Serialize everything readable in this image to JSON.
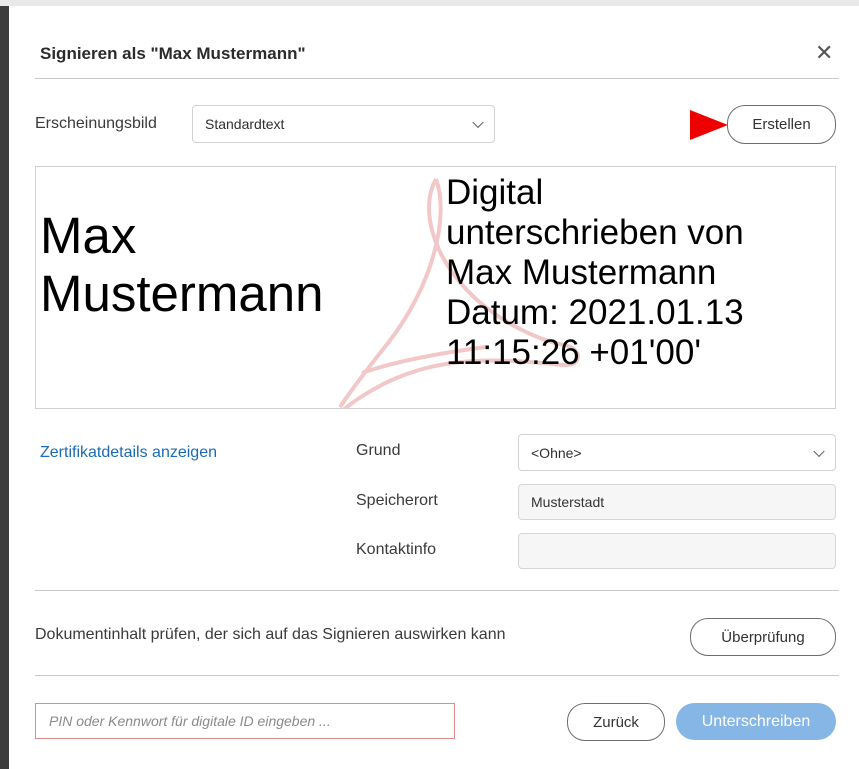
{
  "dialog": {
    "title": "Signieren als \"Max Mustermann\"",
    "close_icon": "close-icon"
  },
  "appearance": {
    "label": "Erscheinungsbild",
    "selected": "Standardtext",
    "create_button": "Erstellen"
  },
  "preview": {
    "name_line1": "Max",
    "name_line2": "Mustermann",
    "info_lines": [
      "Digital",
      "unterschrieben von",
      "Max Mustermann",
      "Datum: 2021.01.13",
      "11:15:26 +01'00'"
    ],
    "watermark_icon": "acrobat-logo-icon"
  },
  "details": {
    "certificate_link": "Zertifikatdetails anzeigen",
    "reason_label": "Grund",
    "reason_value": "<Ohne>",
    "location_label": "Speicherort",
    "location_value": "Musterstadt",
    "contact_label": "Kontaktinfo",
    "contact_value": ""
  },
  "review": {
    "text": "Dokumentinhalt prüfen, der sich auf das Signieren auswirken kann",
    "button": "Überprüfung"
  },
  "footer": {
    "pin_placeholder": "PIN oder Kennwort für digitale ID eingeben ...",
    "back_button": "Zurück",
    "sign_button": "Unterschreiben"
  },
  "colors": {
    "annotation_arrow": "#ee0000",
    "link": "#1a6bb5",
    "primary_button": "#86b6e6",
    "pin_border": "#e08a8a"
  }
}
